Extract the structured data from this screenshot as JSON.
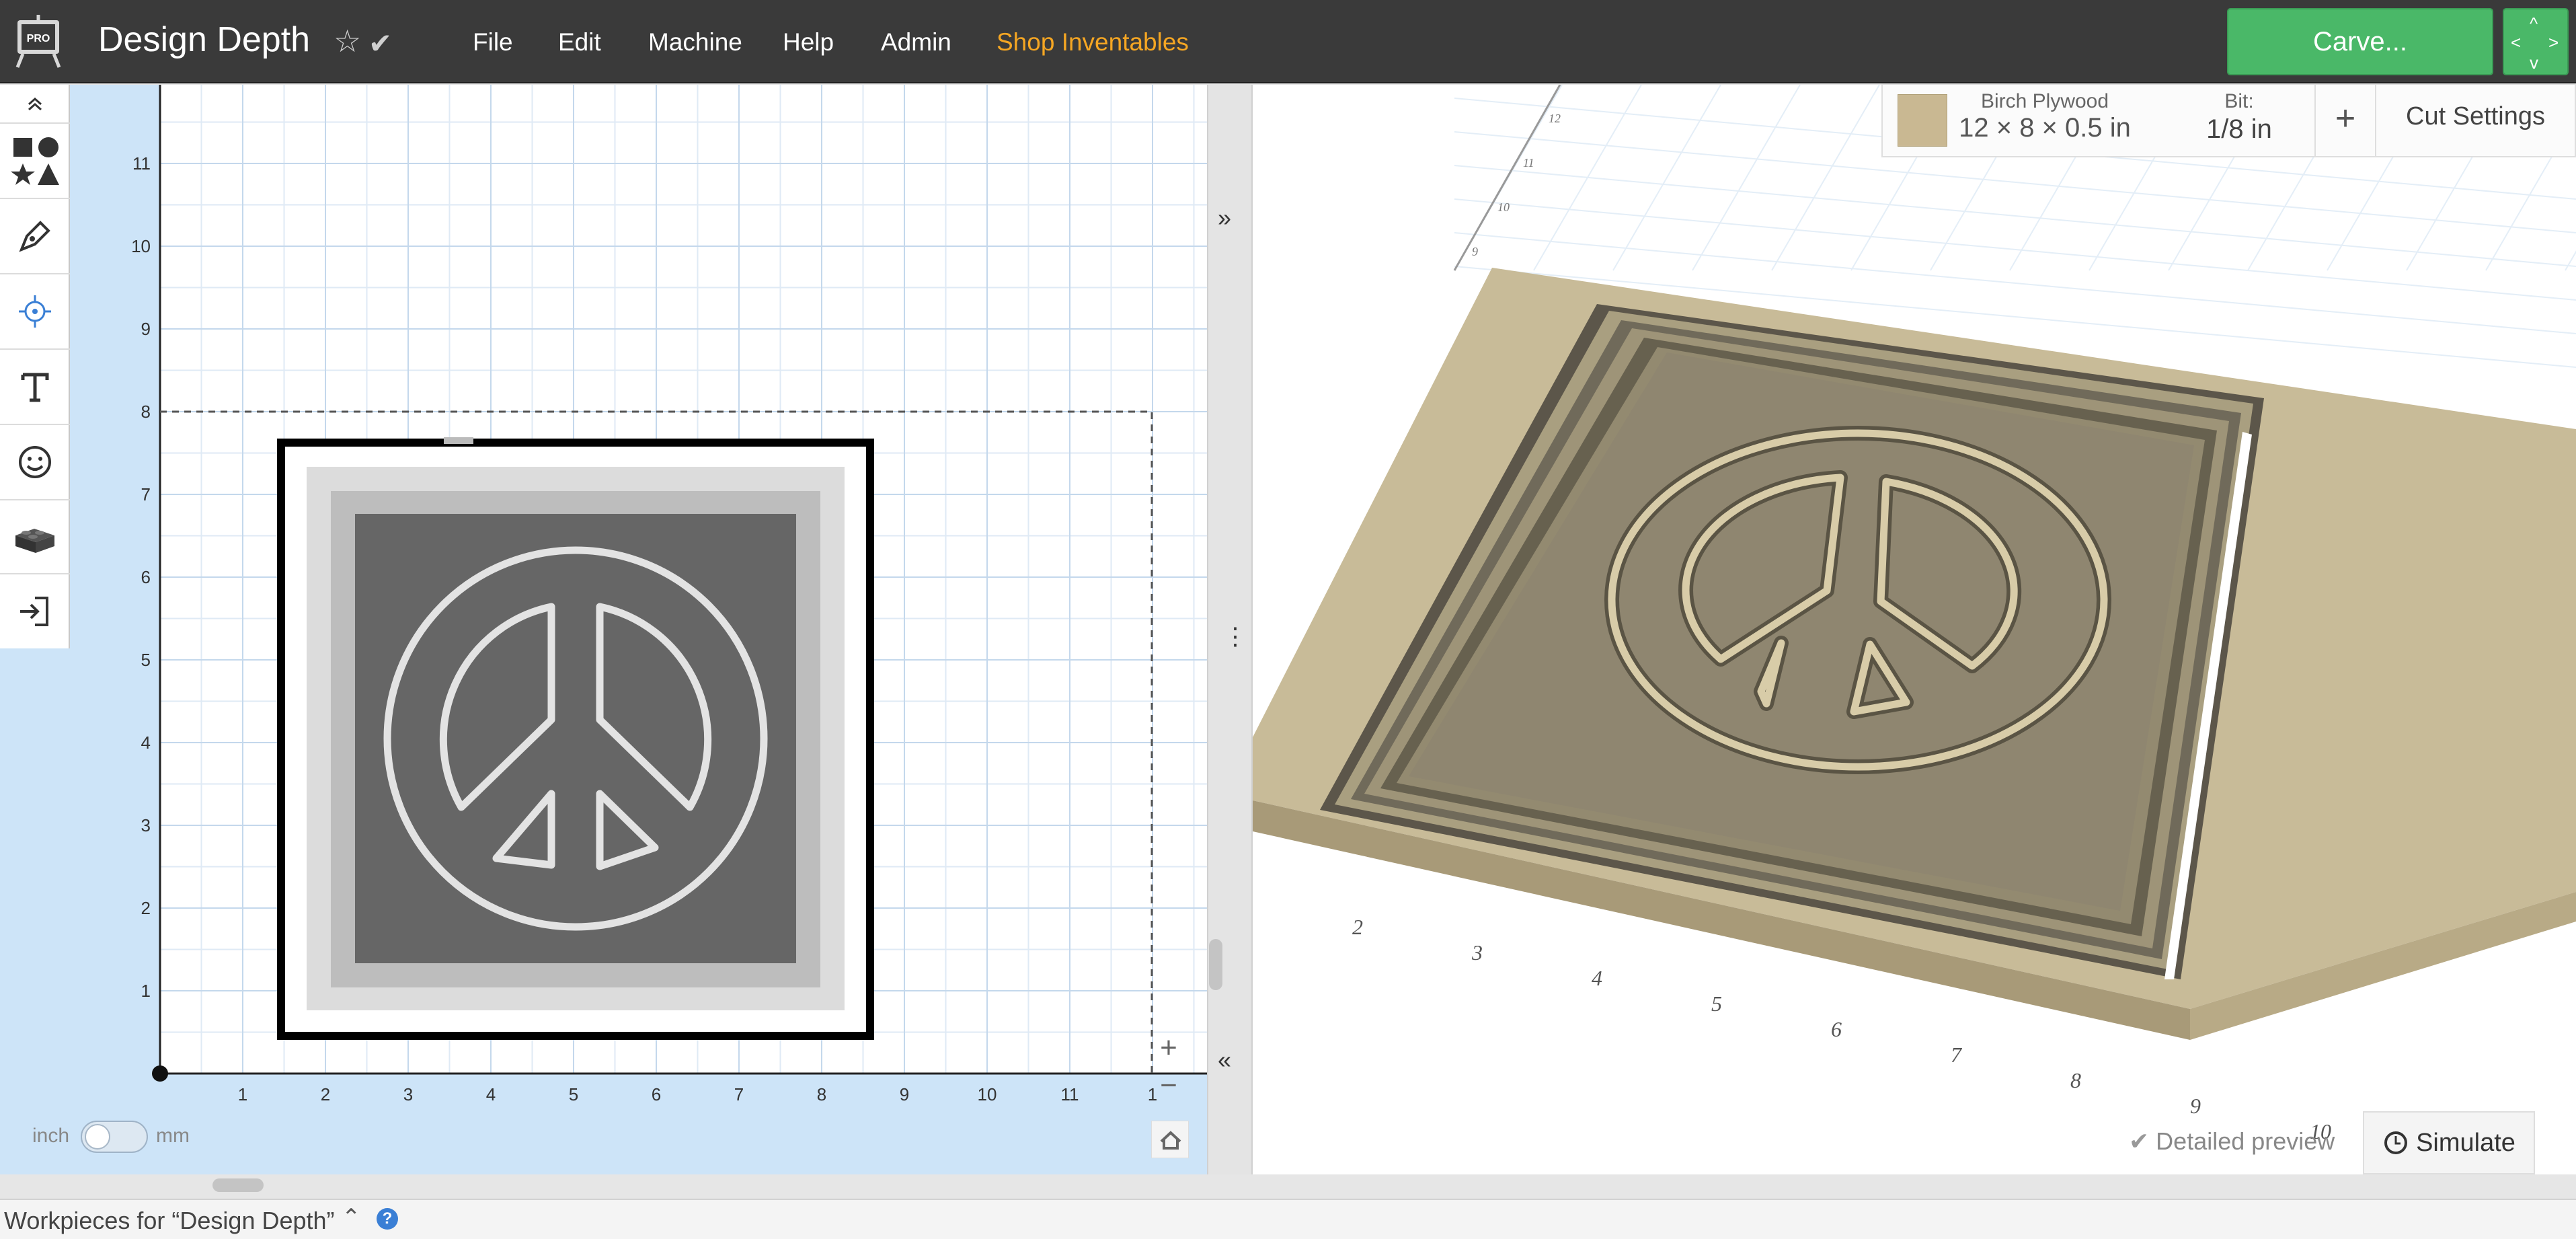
{
  "app": {
    "logo_badge": "PRO",
    "document_title": "Design Depth",
    "star_icon": "star-outline-icon",
    "saved_icon": "checkmark-icon"
  },
  "menu": {
    "file": "File",
    "edit": "Edit",
    "machine": "Machine",
    "help": "Help",
    "admin": "Admin",
    "shop": "Shop Inventables"
  },
  "actions": {
    "carve": "Carve...",
    "nav_icon": "directional-arrows-icon"
  },
  "tools": [
    "chevron-up-icon",
    "shapes-icon",
    "pen-icon",
    "point-target-icon",
    "text-icon",
    "emoji-icon",
    "lego-brick-icon",
    "import-icon"
  ],
  "canvas": {
    "y_ticks": [
      "1",
      "2",
      "3",
      "4",
      "5",
      "6",
      "7",
      "8",
      "9",
      "10",
      "11"
    ],
    "x_ticks": [
      "1",
      "2",
      "3",
      "4",
      "5",
      "6",
      "7",
      "8",
      "9",
      "10",
      "11",
      "1"
    ],
    "units": {
      "inch": "inch",
      "mm": "mm",
      "selected": "inch"
    },
    "zoom_in": "+",
    "zoom_out": "−"
  },
  "preview": {
    "material_name": "Birch Plywood",
    "material_dims": "12 × 8 × 0.5 in",
    "bit_label": "Bit:",
    "bit_value": "1/8 in",
    "add_button": "+",
    "cut_settings": "Cut Settings",
    "detailed_preview": "Detailed preview",
    "simulate": "Simulate",
    "x_ticks": [
      "2",
      "3",
      "4",
      "5",
      "6",
      "7",
      "8",
      "9",
      "10"
    ],
    "y_ticks": [
      "12",
      "11",
      "10",
      "9"
    ],
    "colors": {
      "wood": "#c8bb98",
      "wood_side": "#a89a78",
      "pocket": "#8f8670"
    }
  },
  "footer": {
    "workpieces": "Workpieces for “Design Depth”"
  },
  "colors": {
    "topbar": "#3a3a3a",
    "accent_green": "#4ab868",
    "shop_orange": "#f5a623",
    "canvas_bg": "#cde4f8",
    "help_blue": "#3a7fd5"
  }
}
